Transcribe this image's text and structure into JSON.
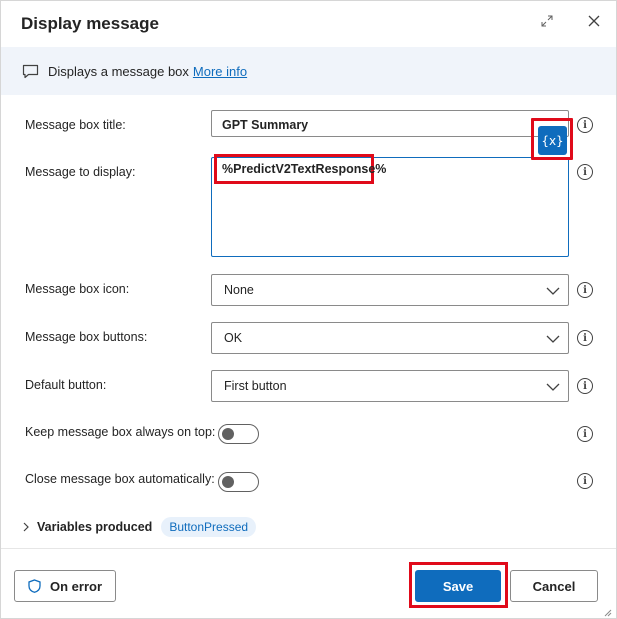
{
  "dialog": {
    "title": "Display message",
    "expand_icon": "expand-icon",
    "close_icon": "close-icon"
  },
  "info_bar": {
    "icon": "message-icon",
    "text": "Displays a message box",
    "link": "More info"
  },
  "fields": {
    "title_label": "Message box title:",
    "title_value": "GPT Summary",
    "message_label": "Message to display:",
    "message_value": "%PredictV2TextResponse%",
    "variable_button": "{x}",
    "icon_label": "Message box icon:",
    "icon_value": "None",
    "buttons_label": "Message box buttons:",
    "buttons_value": "OK",
    "default_label": "Default button:",
    "default_value": "First button",
    "ontop_label": "Keep message box always on top:",
    "ontop_on": false,
    "autoclose_label": "Close message box automatically:",
    "autoclose_on": false
  },
  "variables": {
    "label": "Variables produced",
    "items": [
      "ButtonPressed"
    ]
  },
  "footer": {
    "on_error": "On error",
    "save": "Save",
    "cancel": "Cancel"
  },
  "colors": {
    "accent": "#0f6cbd",
    "highlight": "#e00a1a",
    "info_bar_bg": "#f0f4fa"
  }
}
